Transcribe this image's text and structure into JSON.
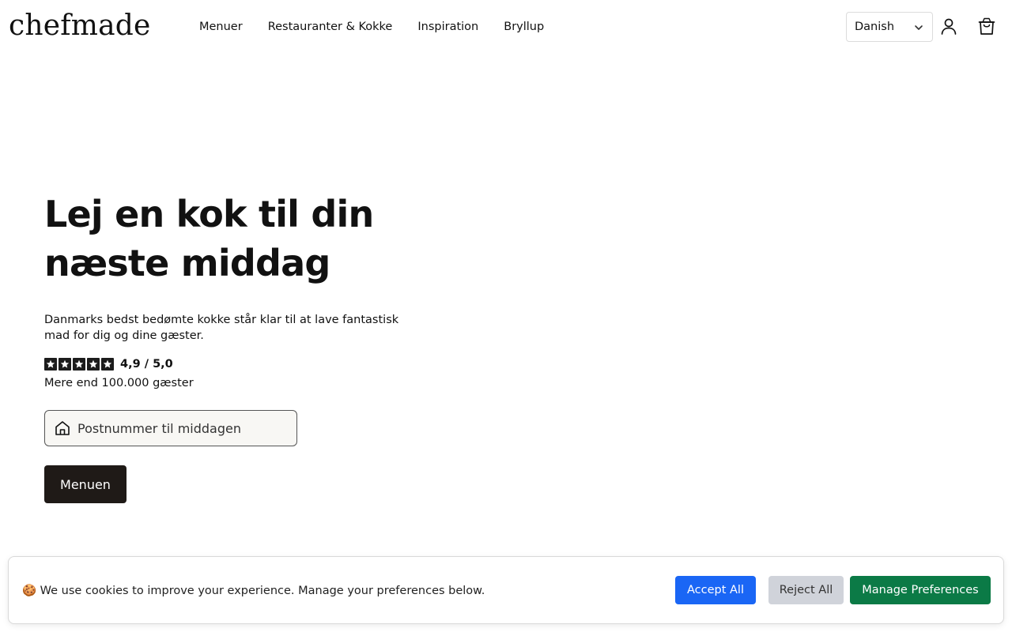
{
  "header": {
    "logo": "chefmade",
    "nav": [
      {
        "label": "Menuer"
      },
      {
        "label": "Restauranter & Kokke"
      },
      {
        "label": "Inspiration"
      },
      {
        "label": "Bryllup"
      }
    ],
    "language": {
      "selected": "Danish"
    },
    "icons": {
      "user": "user-icon",
      "cart": "shopping-bag-icon",
      "chevron": "chevron-down-icon"
    }
  },
  "hero": {
    "title_line1": "Lej en kok til din",
    "title_line2": "næste middag",
    "subtitle": "Danmarks bedst bedømte kokke står klar til at lave fantastisk mad for dig og dine gæster.",
    "rating": {
      "stars": 5,
      "text": "4,9 / 5,0"
    },
    "guests": "Mere end 100.000 gæster",
    "zip_placeholder": "Postnummer til middagen",
    "cta_label": "Menuen"
  },
  "cookie_banner": {
    "message": "🍪 We use cookies to improve your experience. Manage your preferences below.",
    "accept_label": "Accept All",
    "reject_label": "Reject All",
    "manage_label": "Manage Preferences",
    "colors": {
      "accept": "#1a66f5",
      "reject": "#d0d3da",
      "manage": "#0b7a46"
    }
  }
}
